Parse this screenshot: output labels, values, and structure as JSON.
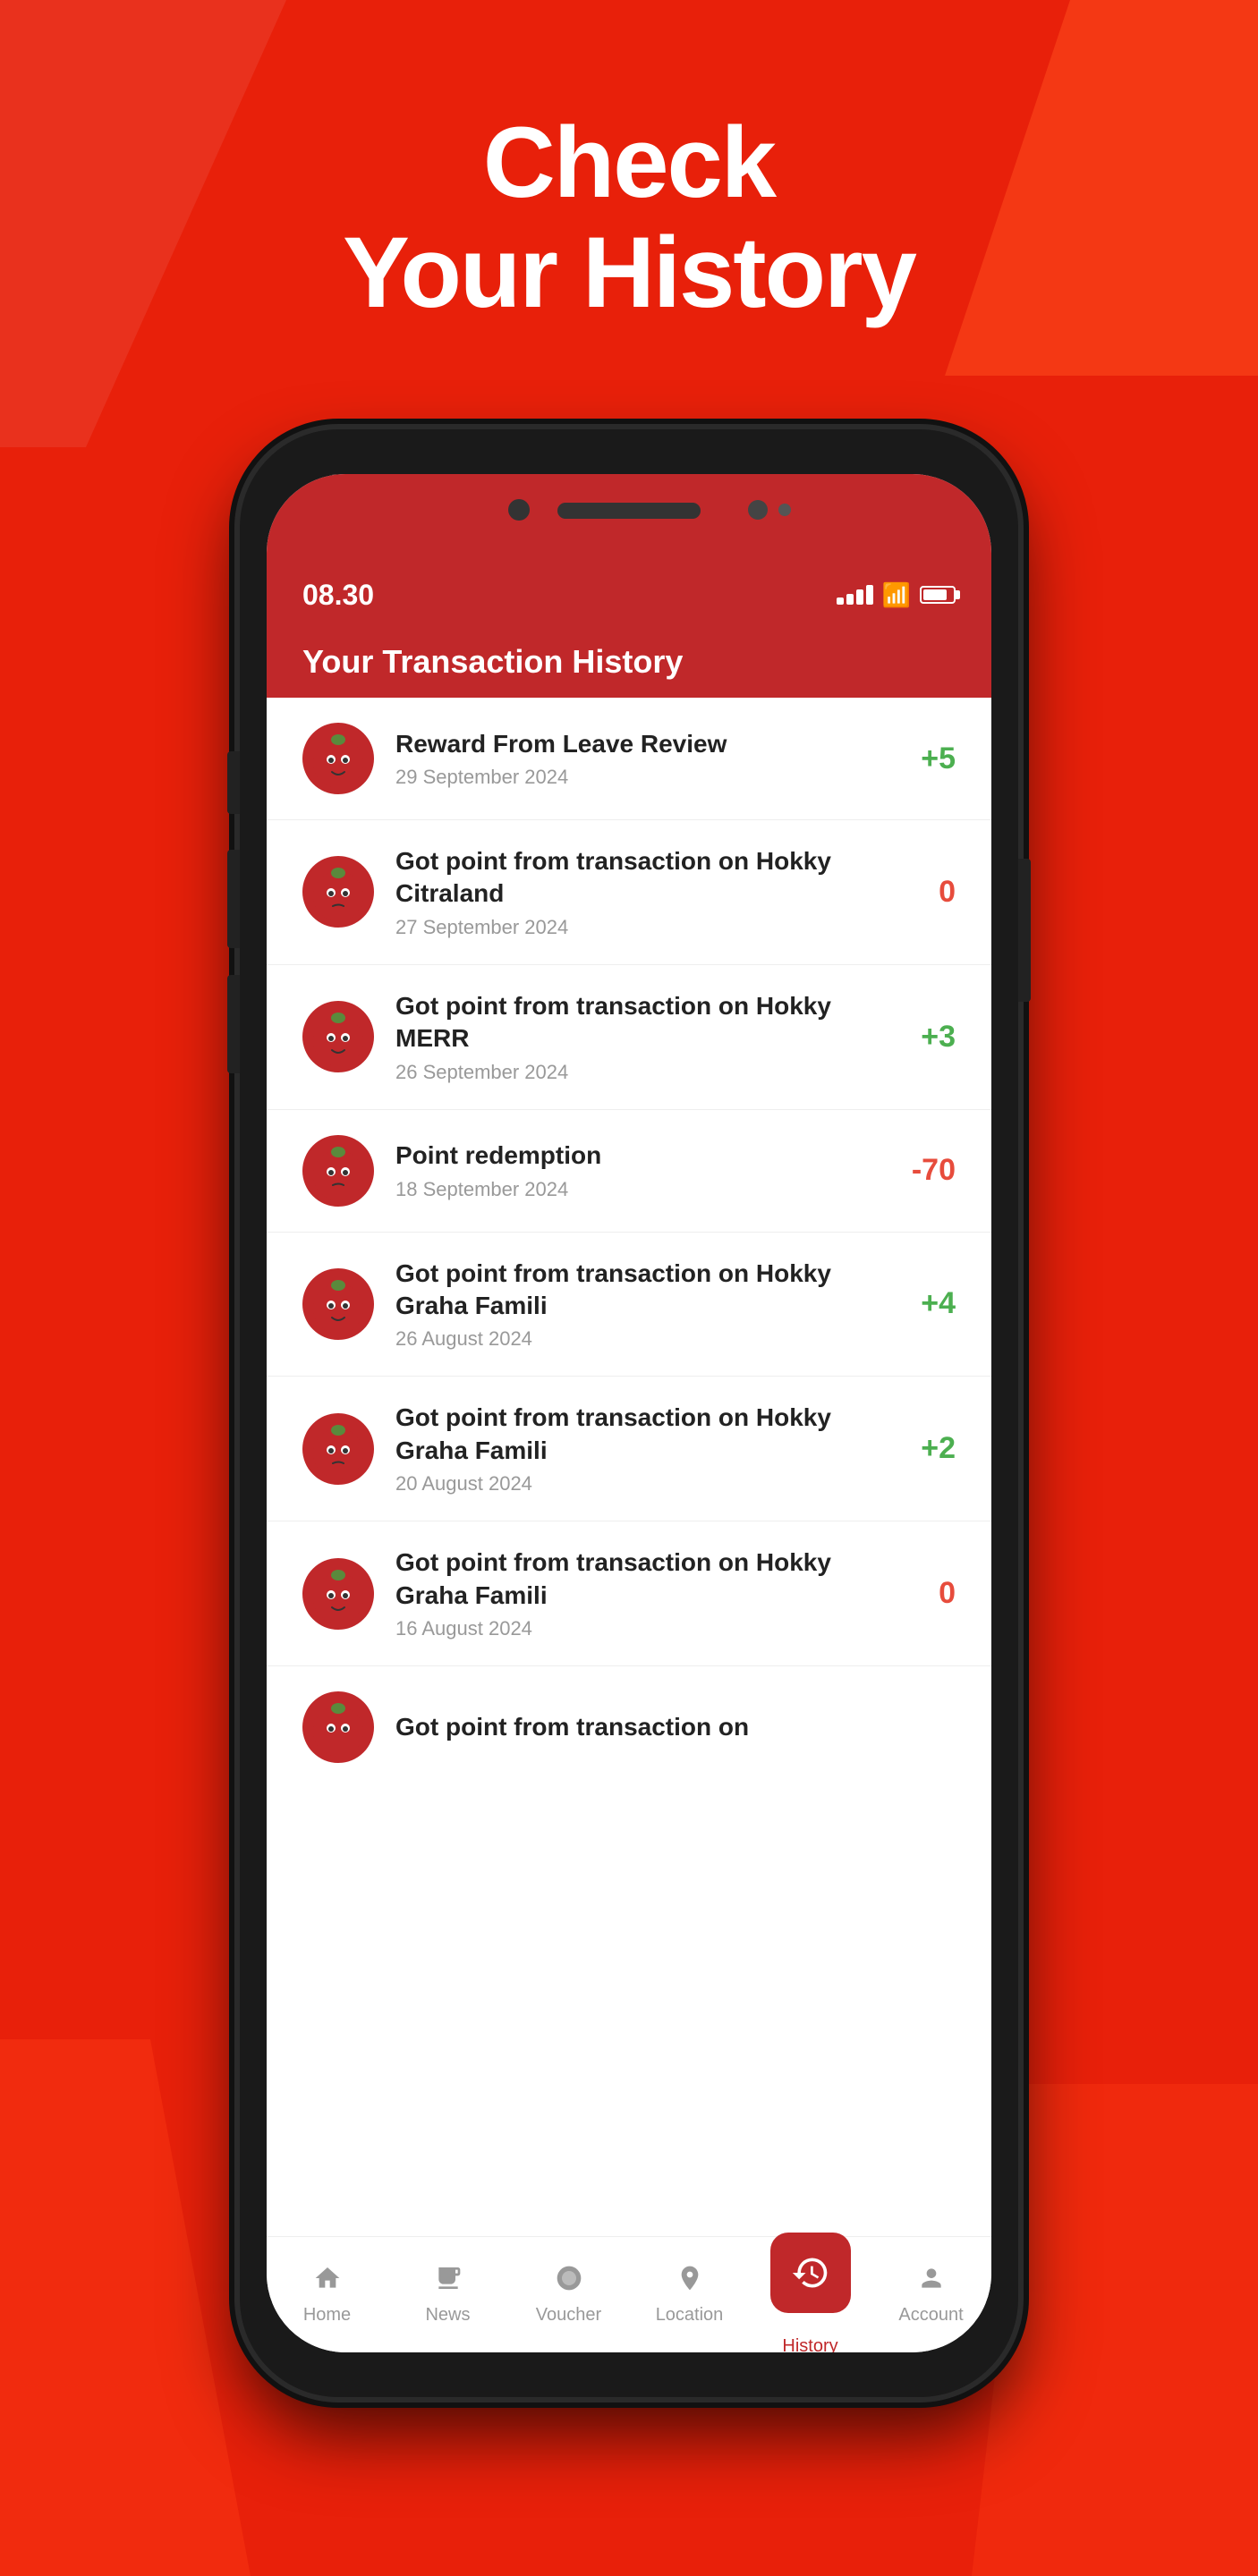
{
  "page": {
    "background_color": "#e8200a",
    "headline_line1": "Check",
    "headline_line2": "Your History"
  },
  "status_bar": {
    "time": "08.30",
    "signal_label": "signal",
    "wifi_label": "wifi",
    "battery_label": "battery"
  },
  "app_header": {
    "title": "Your Transaction History"
  },
  "transactions": [
    {
      "id": 1,
      "title": "Reward From Leave Review",
      "date": "29 September 2024",
      "points": "+5",
      "points_type": "positive"
    },
    {
      "id": 2,
      "title": "Got point from transaction on Hokky Citraland",
      "date": "27 September 2024",
      "points": "0",
      "points_type": "zero"
    },
    {
      "id": 3,
      "title": "Got point from transaction on Hokky MERR",
      "date": "26 September 2024",
      "points": "+3",
      "points_type": "positive"
    },
    {
      "id": 4,
      "title": "Point redemption",
      "date": "18 September 2024",
      "points": "-70",
      "points_type": "negative"
    },
    {
      "id": 5,
      "title": "Got point from transaction on Hokky Graha Famili",
      "date": "26 August 2024",
      "points": "+4",
      "points_type": "positive"
    },
    {
      "id": 6,
      "title": "Got point from transaction on Hokky Graha Famili",
      "date": "20 August 2024",
      "points": "+2",
      "points_type": "positive"
    },
    {
      "id": 7,
      "title": "Got point from transaction on Hokky Graha Famili",
      "date": "16 August 2024",
      "points": "0",
      "points_type": "zero"
    },
    {
      "id": 8,
      "title": "Got point from transaction on",
      "date": "",
      "points": "",
      "points_type": "",
      "partial": true
    }
  ],
  "bottom_nav": {
    "items": [
      {
        "id": "home",
        "label": "Home",
        "icon": "🏠",
        "active": false
      },
      {
        "id": "news",
        "label": "News",
        "icon": "📰",
        "active": false
      },
      {
        "id": "voucher",
        "label": "Voucher",
        "icon": "🍅",
        "active": false
      },
      {
        "id": "location",
        "label": "Location",
        "icon": "📍",
        "active": false
      },
      {
        "id": "history",
        "label": "History",
        "icon": "⏱",
        "active": true
      },
      {
        "id": "account",
        "label": "Account",
        "icon": "👤",
        "active": false
      }
    ]
  }
}
